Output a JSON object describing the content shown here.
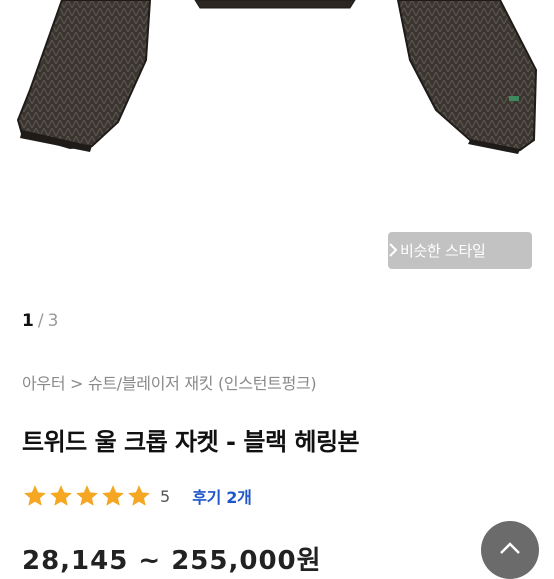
{
  "similar_button": {
    "label": "비슷한 스타일",
    "icon": "chevron-right-icon"
  },
  "pager": {
    "current": "1",
    "separator": "/",
    "total": "3"
  },
  "breadcrumb": "아우터 > 슈트/블레이저 재킷 (인스턴트펑크)",
  "product": {
    "title": "트위드 울 크롭 자켓 - 블랙 헤링본",
    "rating": {
      "stars": 5,
      "score": "5"
    },
    "reviews_label": "후기 2개",
    "price_text": "28,145 ~ 255,000원"
  },
  "colors": {
    "star": "#f5a623",
    "review_link": "#1f56c9",
    "top_button": "#6b6b6b"
  },
  "scroll_top_button": {
    "icon": "chevron-up-icon"
  }
}
